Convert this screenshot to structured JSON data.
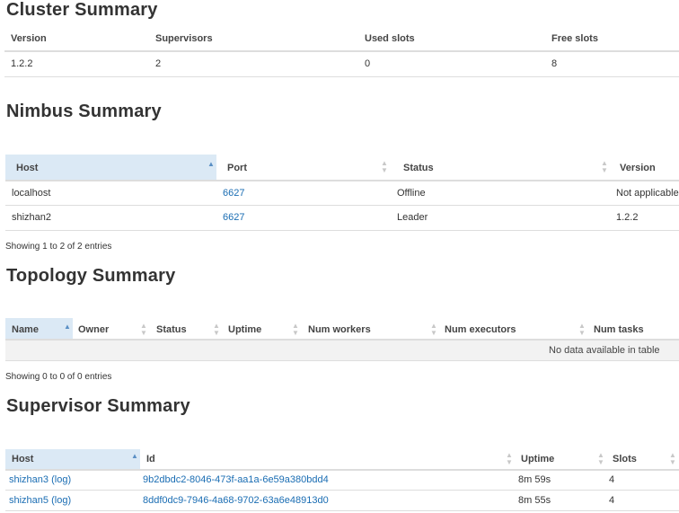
{
  "cluster": {
    "title": "Cluster Summary",
    "headers": [
      "Version",
      "Supervisors",
      "Used slots",
      "Free slots"
    ],
    "row": [
      "1.2.2",
      "2",
      "0",
      "8"
    ]
  },
  "nimbus": {
    "title": "Nimbus Summary",
    "headers": [
      "Host",
      "Port",
      "Status",
      "Version"
    ],
    "rows": [
      [
        "localhost",
        "6627",
        "Offline",
        "Not applicable"
      ],
      [
        "shizhan2",
        "6627",
        "Leader",
        "1.2.2"
      ]
    ],
    "info": "Showing 1 to 2 of 2 entries"
  },
  "topology": {
    "title": "Topology Summary",
    "headers": [
      "Name",
      "Owner",
      "Status",
      "Uptime",
      "Num workers",
      "Num executors",
      "Num tasks"
    ],
    "empty_text": "No data available in table",
    "info": "Showing 0 to 0 of 0 entries"
  },
  "supervisor": {
    "title": "Supervisor Summary",
    "headers": [
      "Host",
      "Id",
      "Uptime",
      "Slots"
    ],
    "rows": [
      {
        "host": "shizhan3",
        "log": "(log)",
        "id": "9b2dbdc2-8046-473f-aa1a-6e59a380bdd4",
        "uptime": "8m 59s",
        "slots": "4"
      },
      {
        "host": "shizhan5",
        "log": "(log)",
        "id": "8ddf0dc9-7946-4a68-9702-63a6e48913d0",
        "uptime": "8m 55s",
        "slots": "4"
      }
    ]
  },
  "colors": {
    "link": "#1a6db3",
    "sorted_header": "#dbe9f5",
    "header_bg": "#f2f2f2"
  },
  "icons": {
    "sort_asc": "sort-asc-icon",
    "sort_both": "sort-both-icon"
  }
}
